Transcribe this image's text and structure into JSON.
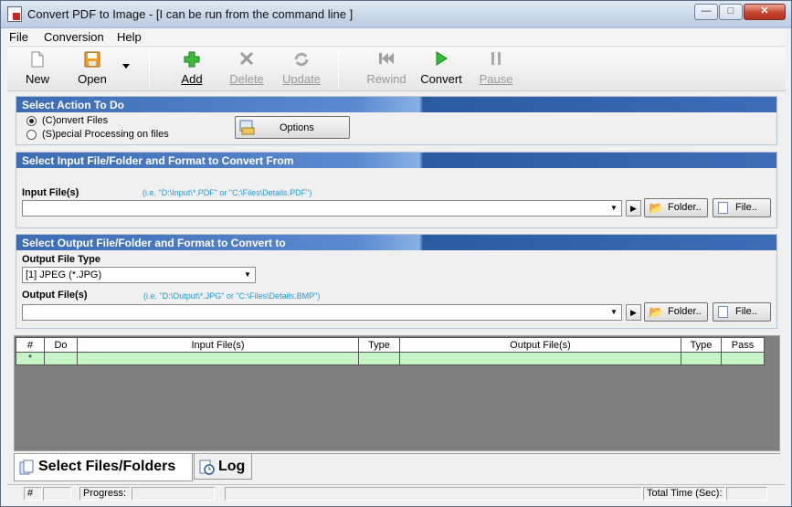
{
  "window": {
    "title": "Convert PDF to Image - [I can be run from the command line ]"
  },
  "menu": [
    "File",
    "Conversion",
    "Help"
  ],
  "toolbar": {
    "new": "New",
    "open": "Open",
    "add": "Add",
    "delete": "Delete",
    "update": "Update",
    "rewind": "Rewind",
    "convert": "Convert",
    "pause": "Pause"
  },
  "action_section": {
    "heading": "Select Action To Do",
    "convert_files": "(C)onvert Files",
    "special_processing": "(S)pecial Processing on files",
    "selected": "convert_files",
    "options_button": "Options"
  },
  "input_section": {
    "heading": "Select Input File/Folder and Format to Convert From",
    "label": "Input File(s)",
    "hint": "(i.e. \"D:\\Input\\*.PDF\"  or \"C:\\Files\\Details.PDF\")",
    "value": "",
    "folder_button": "Folder..",
    "file_button": "File.."
  },
  "output_section": {
    "heading": "Select Output File/Folder and Format to Convert to",
    "type_label": "Output File Type",
    "type_value": "[1] JPEG (*.JPG)",
    "label": "Output File(s)",
    "hint": "(i.e. \"D:\\Output\\*.JPG\"  or \"C:\\Files\\Details.BMP\")",
    "value": "",
    "folder_button": "Folder..",
    "file_button": "File.."
  },
  "grid": {
    "columns": [
      "#",
      "Do",
      "Input File(s)",
      "Type",
      "Output File(s)",
      "Type",
      "Pass"
    ],
    "new_row_marker": "*"
  },
  "tabs": [
    "Select Files/Folders",
    "Log"
  ],
  "status": {
    "hash": "#",
    "progress_label": "Progress:",
    "total_time_label": "Total Time (Sec):"
  },
  "colors": {
    "section_header": "#3c6cb3",
    "grid_row": "#c8f5c8",
    "hint_text": "#1e9ad6"
  }
}
